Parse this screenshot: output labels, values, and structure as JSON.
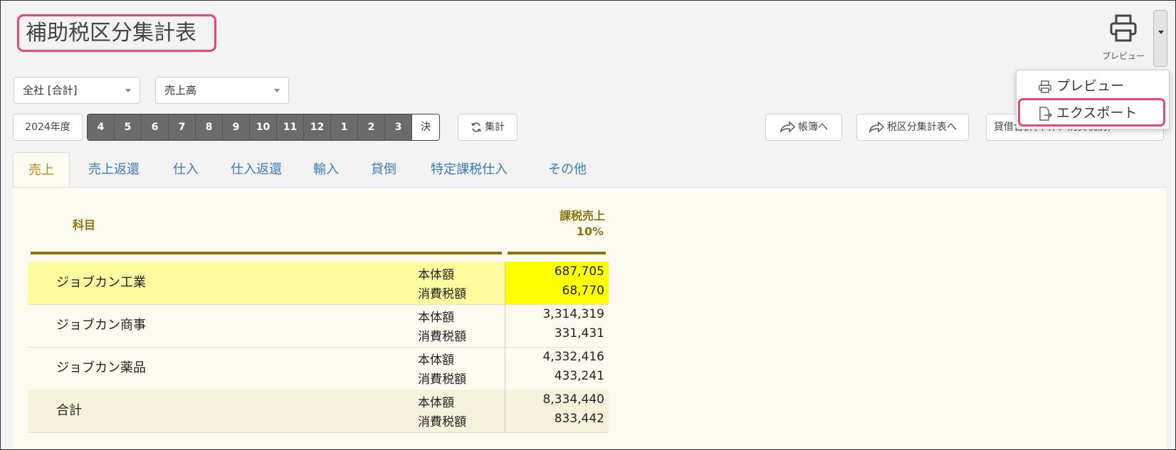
{
  "header": {
    "title": "補助税区分集計表"
  },
  "print": {
    "label": "プレビュー"
  },
  "filters": {
    "company": "全社 [合計]",
    "account": "売上高"
  },
  "period": {
    "year": "2024年度",
    "months": [
      "4",
      "5",
      "6",
      "7",
      "8",
      "9",
      "10",
      "11",
      "12",
      "1",
      "2",
      "3"
    ],
    "closing": "決",
    "aggregate": "集計"
  },
  "actions": {
    "ledger": "帳簿へ",
    "tax_summary": "税区分集計表へ",
    "balance": "貸借合計(本体、消費税別)"
  },
  "menu": {
    "items": [
      "プレビュー",
      "エクスポート"
    ]
  },
  "tabs": [
    "売上",
    "売上返還",
    "仕入",
    "仕入返還",
    "輸入",
    "貸倒",
    "特定課税仕入",
    "その他"
  ],
  "table": {
    "col_subject": "科目",
    "col_value_line1": "課税売上",
    "col_value_line2": "10%",
    "label_base": "本体額",
    "label_tax": "消費税額",
    "rows": [
      {
        "name": "ジョブカン工業",
        "base": "687,705",
        "tax": "68,770"
      },
      {
        "name": "ジョブカン商事",
        "base": "3,314,319",
        "tax": "331,431"
      },
      {
        "name": "ジョブカン薬品",
        "base": "4,332,416",
        "tax": "433,241"
      },
      {
        "name": "合計",
        "base": "8,334,440",
        "tax": "833,442"
      }
    ]
  },
  "colors": {
    "accent": "#e8467c",
    "tab_text": "#3d7bb5",
    "header_text": "#8b7212",
    "highlight": "#ffff00"
  }
}
